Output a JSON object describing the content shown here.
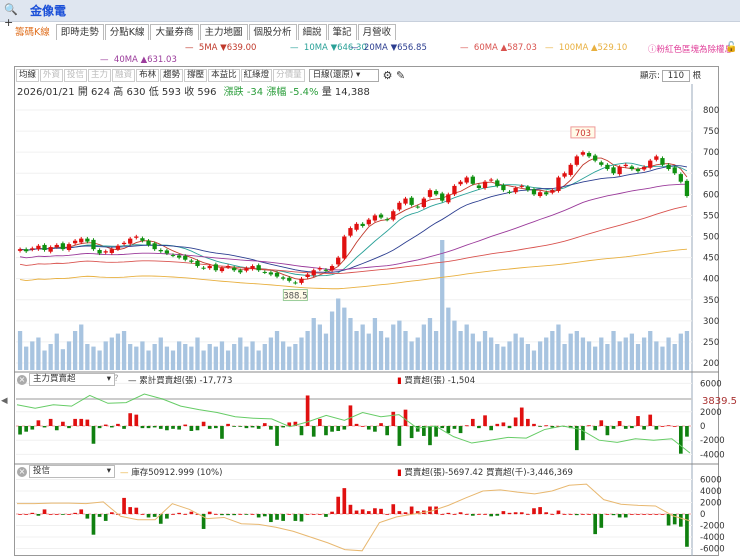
{
  "header": {
    "search_icon": "magnifier-plus",
    "stock_name": "金像電"
  },
  "tabs": [
    "籌碼K線",
    "即時走勢",
    "分點K線",
    "大量券商",
    "主力地圖",
    "個股分析",
    "細說",
    "筆記",
    "月營收"
  ],
  "ma_legend": [
    {
      "label": "5MA ▼639.00",
      "color": "#c0392b"
    },
    {
      "label": "10MA ▼646.30",
      "color": "#2aa198"
    },
    {
      "label": "20MA ▼656.85",
      "color": "#2c3e90"
    },
    {
      "label": "60MA ▲587.03",
      "color": "#d9534f"
    },
    {
      "label": "100MA ▲529.10",
      "color": "#e8b040"
    },
    {
      "label": "40MA ▲631.03",
      "color": "#9b3b9b"
    }
  ],
  "notice": "ⓘ粉紅色區塊為除權息",
  "toolbar": {
    "buttons": [
      {
        "l": "均線",
        "on": true
      },
      {
        "l": "外資",
        "on": false
      },
      {
        "l": "投信",
        "on": false
      },
      {
        "l": "主力",
        "on": false
      },
      {
        "l": "融資",
        "on": false
      },
      {
        "l": "布林",
        "on": true
      },
      {
        "l": "趨勢",
        "on": true
      },
      {
        "l": "撐壓",
        "on": true
      },
      {
        "l": "本益比",
        "on": true
      },
      {
        "l": "紅綠燈",
        "on": true
      },
      {
        "l": "分價量",
        "on": false
      }
    ],
    "period": "日線(還原)",
    "show_label": "顯示:",
    "show_value": "110",
    "show_unit": "根"
  },
  "info": {
    "date": "2026/01/21",
    "open": "開 624",
    "high": "高 630",
    "low": "低 593",
    "close": "收 596",
    "change": "漲跌 -34",
    "pct": "漲幅 -5.4%",
    "vol": "量 14,388"
  },
  "chart_data": {
    "type": "candlestick",
    "y_ticks": [
      "800",
      "750",
      "700",
      "650",
      "600",
      "550",
      "500",
      "450",
      "400",
      "350",
      "300",
      "250",
      "200"
    ],
    "ylim": [
      200,
      800
    ],
    "annotations": {
      "high": "703",
      "low": "388.5"
    },
    "closes": [
      470,
      465,
      472,
      478,
      468,
      475,
      480,
      470,
      482,
      490,
      495,
      488,
      470,
      460,
      465,
      470,
      478,
      485,
      495,
      500,
      490,
      480,
      470,
      465,
      460,
      455,
      450,
      445,
      440,
      430,
      425,
      430,
      420,
      425,
      430,
      420,
      415,
      425,
      430,
      420,
      415,
      410,
      405,
      400,
      395,
      390,
      400,
      410,
      420,
      425,
      420,
      430,
      450,
      500,
      520,
      530,
      525,
      540,
      550,
      545,
      540,
      560,
      580,
      590,
      575,
      570,
      590,
      610,
      600,
      585,
      600,
      620,
      630,
      640,
      625,
      615,
      630,
      635,
      620,
      610,
      605,
      615,
      620,
      610,
      600,
      605,
      600,
      610,
      640,
      650,
      670,
      690,
      700,
      690,
      680,
      670,
      660,
      650,
      665,
      670,
      660,
      655,
      665,
      680,
      690,
      670,
      660,
      650,
      630,
      596
    ],
    "volume": [
      30,
      18,
      22,
      25,
      15,
      20,
      28,
      16,
      22,
      30,
      35,
      20,
      18,
      15,
      22,
      25,
      28,
      30,
      20,
      18,
      22,
      15,
      20,
      25,
      18,
      15,
      22,
      20,
      18,
      25,
      15,
      20,
      18,
      22,
      15,
      20,
      25,
      18,
      22,
      15,
      20,
      25,
      30,
      22,
      18,
      20,
      25,
      30,
      40,
      35,
      28,
      45,
      55,
      48,
      40,
      30,
      35,
      28,
      40,
      30,
      25,
      35,
      38,
      30,
      22,
      25,
      35,
      40,
      30,
      100,
      48,
      38,
      30,
      35,
      28,
      22,
      30,
      25,
      20,
      18,
      22,
      28,
      25,
      20,
      15,
      22,
      25,
      30,
      35,
      20,
      28,
      30,
      25,
      22,
      18,
      25,
      20,
      30,
      22,
      25,
      28,
      20,
      25,
      30,
      22,
      18,
      25,
      20,
      28,
      30
    ],
    "panel1": {
      "select": "主力買賣超",
      "help": "?",
      "line_label": "累計買賣超(張) -17,773",
      "bar_label": "買賣超(張) -1,504",
      "y_ticks": [
        "6000",
        "2000",
        "0",
        "-2000",
        "-4000"
      ],
      "ref_value": "3839.5",
      "bars": [
        -1200,
        -800,
        -500,
        800,
        -200,
        1000,
        -600,
        600,
        -300,
        1000,
        1000,
        900,
        -2500,
        -300,
        200,
        -200,
        300,
        -400,
        1800,
        1600,
        -300,
        -300,
        -200,
        -400,
        -600,
        -400,
        -500,
        200,
        -700,
        -600,
        600,
        -400,
        -300,
        -1800,
        300,
        -100,
        -100,
        -300,
        -200,
        -400,
        400,
        -500,
        -2800,
        -200,
        500,
        600,
        -1300,
        4300,
        -1500,
        1000,
        -1300,
        -800,
        -700,
        -500,
        2900,
        300,
        0,
        -500,
        -800,
        400,
        -1300,
        2000,
        -2800,
        2300,
        -1700,
        -800,
        -1400,
        -2700,
        -1500,
        -300,
        -1000,
        -400,
        -1000,
        100,
        1000,
        -300,
        1500,
        -600,
        300,
        500,
        -300,
        1200,
        2600,
        1000,
        300,
        -100,
        100,
        -200,
        0,
        -100,
        -300,
        -3400,
        -2000,
        100,
        -600,
        800,
        -1300,
        -400,
        700,
        -400,
        -300,
        1400,
        -500,
        1600,
        -500,
        0,
        100,
        0,
        -3900,
        -1500
      ],
      "line": [
        3000,
        2500,
        3000,
        2800,
        4300,
        3200,
        3300,
        4500,
        3800,
        2800,
        2300,
        1900,
        1300,
        1100,
        1000,
        -100,
        600,
        1500,
        800,
        1900,
        1300,
        1600,
        -300,
        0,
        -1500,
        -2400,
        -2000,
        -1600,
        -1700,
        -500,
        0,
        -500,
        -2000,
        -2300,
        -1800,
        -2000,
        -1800,
        -3800
      ]
    },
    "panel2": {
      "select": "投信",
      "line_label": "庫存50912.999 (10%)",
      "bar_label": "買賣超(張)-5697.42 買賣超(千)-3,446,369",
      "y_ticks": [
        "6000",
        "4000",
        "2000",
        "0",
        "-2000",
        "-4000",
        "-6000"
      ],
      "bars": [
        0,
        0,
        200,
        -300,
        800,
        0,
        0,
        -100,
        0,
        200,
        800,
        -800,
        -3600,
        -500,
        -1200,
        300,
        0,
        2800,
        1200,
        1100,
        0,
        -600,
        -500,
        -1700,
        -800,
        0,
        200,
        0,
        400,
        0,
        -2600,
        400,
        0,
        -200,
        -200,
        -200,
        0,
        -100,
        0,
        -600,
        -400,
        -1400,
        -1000,
        -1200,
        0,
        -1200,
        -1300,
        0,
        0,
        0,
        -500,
        400,
        3000,
        4500,
        1600,
        600,
        800,
        500,
        1000,
        900,
        0,
        1700,
        500,
        300,
        1300,
        500,
        600,
        1300,
        1300,
        0,
        200,
        0,
        300,
        0,
        -300,
        0,
        0,
        -400,
        -300,
        500,
        200,
        300,
        300,
        0,
        1000,
        1200,
        300,
        0,
        600,
        0,
        0,
        -200,
        0,
        0,
        -3500,
        -2400,
        0,
        -200,
        -600,
        -600,
        0,
        0,
        0,
        0,
        0,
        0,
        -2000,
        -1800,
        -2200,
        -5700
      ],
      "line": [
        1800,
        1800,
        1900,
        1900,
        1800,
        2100,
        -400,
        -1000,
        -1000,
        1800,
        800,
        -800,
        -600,
        -1700,
        -1800,
        -2300,
        -3000,
        -4000,
        -5000,
        -6200,
        -6400,
        -1500,
        -500,
        0,
        500,
        1500,
        2800,
        4000,
        4200,
        3800,
        3500,
        4000,
        5000,
        5200,
        2500,
        1700,
        1500,
        1400,
        -300,
        -1200
      ]
    }
  }
}
